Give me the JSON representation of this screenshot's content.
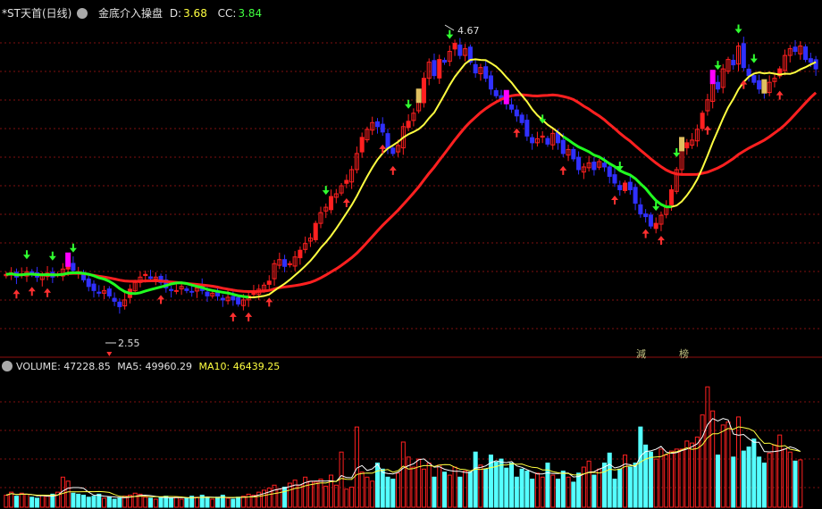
{
  "header": {
    "symbol": "*ST天首(日线)",
    "indicator_name": "金底介入操盘",
    "d_label": "D:",
    "d_value": "3.68",
    "cc_label": "CC:",
    "cc_value": "3.84"
  },
  "volume_header": {
    "vol_label": "VOLUME:",
    "vol_value": "47228.85",
    "ma5_label": "MA5:",
    "ma5_value": "49960.29",
    "ma10_label": "MA10:",
    "ma10_value": "46439.25"
  },
  "annotations": {
    "high_label": "4.67",
    "low_label": "2.55",
    "tag1": "減",
    "tag2": "榜"
  },
  "colors": {
    "up": "#ff2020",
    "down_cyan": "#55ffff",
    "down_blue": "#3030ff",
    "ma_yellow": "#ffff40",
    "ma_red": "#ff2020",
    "ma_green": "#20ff20",
    "grid": "#801010",
    "magenta": "#ff00ff",
    "gold": "#e0c060"
  },
  "chart_data": {
    "type": "candlestick",
    "price_high": 4.67,
    "price_low": 2.55,
    "closes": [
      2.92,
      2.93,
      2.9,
      2.92,
      2.94,
      2.92,
      2.9,
      2.91,
      2.93,
      2.9,
      2.92,
      2.96,
      2.99,
      2.95,
      2.94,
      2.88,
      2.83,
      2.8,
      2.78,
      2.8,
      2.76,
      2.72,
      2.68,
      2.73,
      2.81,
      2.86,
      2.9,
      2.92,
      2.89,
      2.9,
      2.86,
      2.82,
      2.8,
      2.8,
      2.83,
      2.8,
      2.79,
      2.82,
      2.8,
      2.76,
      2.78,
      2.76,
      2.73,
      2.75,
      2.73,
      2.7,
      2.73,
      2.76,
      2.79,
      2.81,
      2.84,
      2.87,
      3.0,
      3.03,
      2.98,
      3.0,
      3.05,
      3.1,
      3.15,
      3.19,
      3.3,
      3.38,
      3.42,
      3.5,
      3.52,
      3.58,
      3.62,
      3.7,
      3.82,
      3.94,
      4.0,
      4.05,
      4.02,
      3.98,
      3.86,
      3.82,
      3.88,
      4.02,
      4.06,
      4.12,
      4.21,
      4.38,
      4.5,
      4.4,
      4.52,
      4.5,
      4.58,
      4.64,
      4.55,
      4.6,
      4.5,
      4.42,
      4.46,
      4.38,
      4.3,
      4.25,
      4.22,
      4.2,
      4.15,
      4.1,
      4.05,
      3.95,
      3.9,
      3.93,
      3.95,
      3.89,
      3.97,
      3.9,
      3.82,
      3.85,
      3.78,
      3.7,
      3.72,
      3.75,
      3.7,
      3.76,
      3.72,
      3.65,
      3.6,
      3.55,
      3.6,
      3.55,
      3.45,
      3.37,
      3.35,
      3.28,
      3.3,
      3.36,
      3.42,
      3.55,
      3.7,
      3.85,
      3.9,
      3.92,
      4.0,
      4.12,
      4.22,
      4.35,
      4.3,
      4.45,
      4.52,
      4.48,
      4.62,
      4.46,
      4.4,
      4.35,
      4.3,
      4.28,
      4.35,
      4.38,
      4.45,
      4.55,
      4.6,
      4.58,
      4.62,
      4.52,
      4.5,
      4.45
    ],
    "volumes": [
      12000,
      15000,
      11000,
      14000,
      13000,
      10000,
      9000,
      12000,
      11000,
      13000,
      15000,
      30000,
      26000,
      14000,
      13000,
      12000,
      10000,
      11000,
      13000,
      9000,
      10000,
      8000,
      9000,
      11000,
      12000,
      14000,
      13000,
      10000,
      9000,
      8000,
      10000,
      11000,
      9000,
      10000,
      8000,
      9000,
      11000,
      10000,
      12000,
      9000,
      8000,
      10000,
      12000,
      9000,
      8000,
      10000,
      11000,
      13000,
      12000,
      15000,
      17000,
      19000,
      22000,
      18000,
      20000,
      24000,
      27000,
      22000,
      30000,
      26000,
      25000,
      28000,
      21000,
      32000,
      22000,
      55000,
      18000,
      20000,
      80000,
      35000,
      30000,
      26000,
      44000,
      38000,
      30000,
      28000,
      34000,
      65000,
      50000,
      40000,
      48000,
      38000,
      44000,
      30000,
      42000,
      35000,
      32000,
      40000,
      30000,
      36000,
      35000,
      55000,
      42000,
      38000,
      52000,
      45000,
      48000,
      39000,
      44000,
      30000,
      38000,
      36000,
      28000,
      34000,
      30000,
      44000,
      32000,
      28000,
      36000,
      30000,
      25000,
      34000,
      40000,
      46000,
      32000,
      38000,
      44000,
      54000,
      28000,
      38000,
      52000,
      40000,
      44000,
      80000,
      62000,
      55000,
      48000,
      58000,
      52000,
      56000,
      58000,
      58000,
      66000,
      64000,
      70000,
      92000,
      120000,
      96000,
      52000,
      82000,
      85000,
      50000,
      90000,
      56000,
      60000,
      68000,
      50000,
      44000,
      54000,
      62000,
      72000,
      58000,
      55000,
      46000,
      47228
    ],
    "ma5_last": 49960.29,
    "ma10_last": 46439.25
  }
}
